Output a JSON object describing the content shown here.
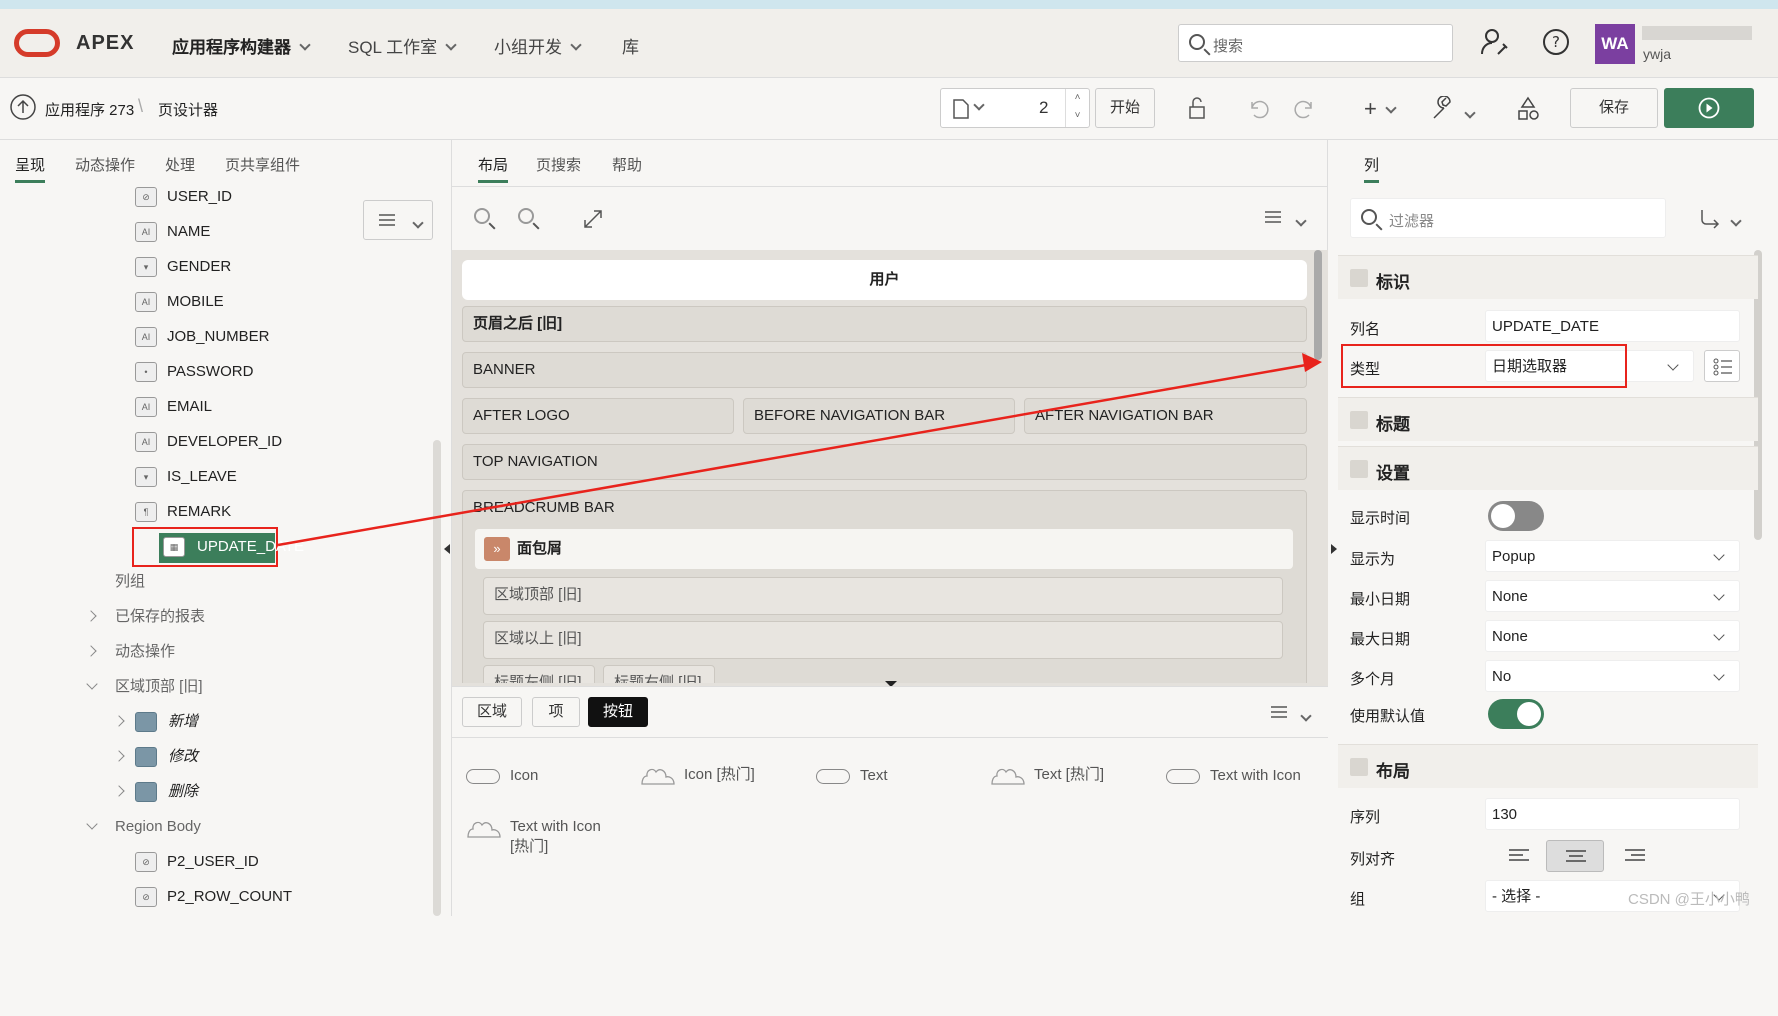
{
  "header": {
    "brand": "APEX",
    "menus": [
      {
        "label": "应用程序构建器"
      },
      {
        "label": "SQL 工作室"
      },
      {
        "label": "小组开发"
      },
      {
        "label": "库"
      }
    ],
    "search_placeholder": "搜索",
    "avatar_initials": "WA",
    "user_name": "ywja"
  },
  "toolbar": {
    "breadcrumb_app": "应用程序 273",
    "breadcrumb_page": "页设计器",
    "page_number": "2",
    "go_label": "开始",
    "save_label": "保存"
  },
  "left_panel": {
    "tabs": [
      "呈现",
      "动态操作",
      "处理",
      "页共享组件"
    ],
    "items": [
      {
        "label": "USER_ID",
        "icon": "hidden-icon"
      },
      {
        "label": "NAME",
        "icon": "text-field-icon"
      },
      {
        "label": "GENDER",
        "icon": "select-list-icon"
      },
      {
        "label": "MOBILE",
        "icon": "text-field-icon"
      },
      {
        "label": "JOB_NUMBER",
        "icon": "text-field-icon"
      },
      {
        "label": "PASSWORD",
        "icon": "password-icon"
      },
      {
        "label": "EMAIL",
        "icon": "text-field-icon"
      },
      {
        "label": "DEVELOPER_ID",
        "icon": "text-field-icon"
      },
      {
        "label": "IS_LEAVE",
        "icon": "select-list-icon"
      },
      {
        "label": "REMARK",
        "icon": "textarea-icon"
      },
      {
        "label": "UPDATE_DATE",
        "icon": "calendar-icon"
      }
    ],
    "column_group": "列组",
    "saved_reports": "已保存的报表",
    "dynamic_actions": "动态操作",
    "region_top": "区域顶部 [旧]",
    "buttons": [
      "新增",
      "修改",
      "删除"
    ],
    "region_body": "Region Body",
    "body_items": [
      "P2_USER_ID",
      "P2_ROW_COUNT"
    ]
  },
  "center": {
    "tabs": [
      "布局",
      "页搜索",
      "帮助"
    ],
    "title_bar": "用户",
    "regions": {
      "after_header": "页眉之后 [旧]",
      "banner": "BANNER",
      "after_logo": "AFTER LOGO",
      "before_nav": "BEFORE NAVIGATION BAR",
      "after_nav": "AFTER NAVIGATION BAR",
      "top_nav": "TOP NAVIGATION",
      "breadcrumb_bar": "BREADCRUMB BAR",
      "breadcrumb": "面包屑",
      "region_top": "区域顶部 [旧]",
      "region_above": "区域以上 [旧]",
      "title_left": "标题左侧 [旧]",
      "title_right": "标题右侧 [旧]"
    },
    "gallery_tabs": [
      "区域",
      "项",
      "按钮"
    ],
    "gallery_items": [
      {
        "label": "Icon",
        "shape": "pill"
      },
      {
        "label": "Icon [热门]",
        "shape": "cloud"
      },
      {
        "label": "Text",
        "shape": "pill"
      },
      {
        "label": "Text [热门]",
        "shape": "cloud"
      },
      {
        "label": "Text with Icon",
        "shape": "pill"
      },
      {
        "label": "Text with Icon [热门]",
        "shape": "cloud"
      }
    ]
  },
  "right_panel": {
    "tab": "列",
    "filter_placeholder": "过滤器",
    "sections": {
      "identity": "标识",
      "heading": "标题",
      "settings": "设置",
      "layout": "布局"
    },
    "fields": {
      "column_name_label": "列名",
      "column_name": "UPDATE_DATE",
      "type_label": "类型",
      "type": "日期选取器",
      "show_time_label": "显示时间",
      "display_as_label": "显示为",
      "display_as": "Popup",
      "min_date_label": "最小日期",
      "min_date": "None",
      "max_date_label": "最大日期",
      "max_date": "None",
      "multi_month_label": "多个月",
      "multi_month": "No",
      "use_default_label": "使用默认值",
      "sequence_label": "序列",
      "sequence": "130",
      "align_label": "列对齐",
      "group_label": "组",
      "group": "- 选择 -"
    },
    "show_time": false,
    "use_default": true
  },
  "watermark": "CSDN @王小小鸭",
  "colors": {
    "accent_green": "#3c7e5b",
    "highlight_red": "#e8231c",
    "avatar_purple": "#7b3fa0"
  }
}
